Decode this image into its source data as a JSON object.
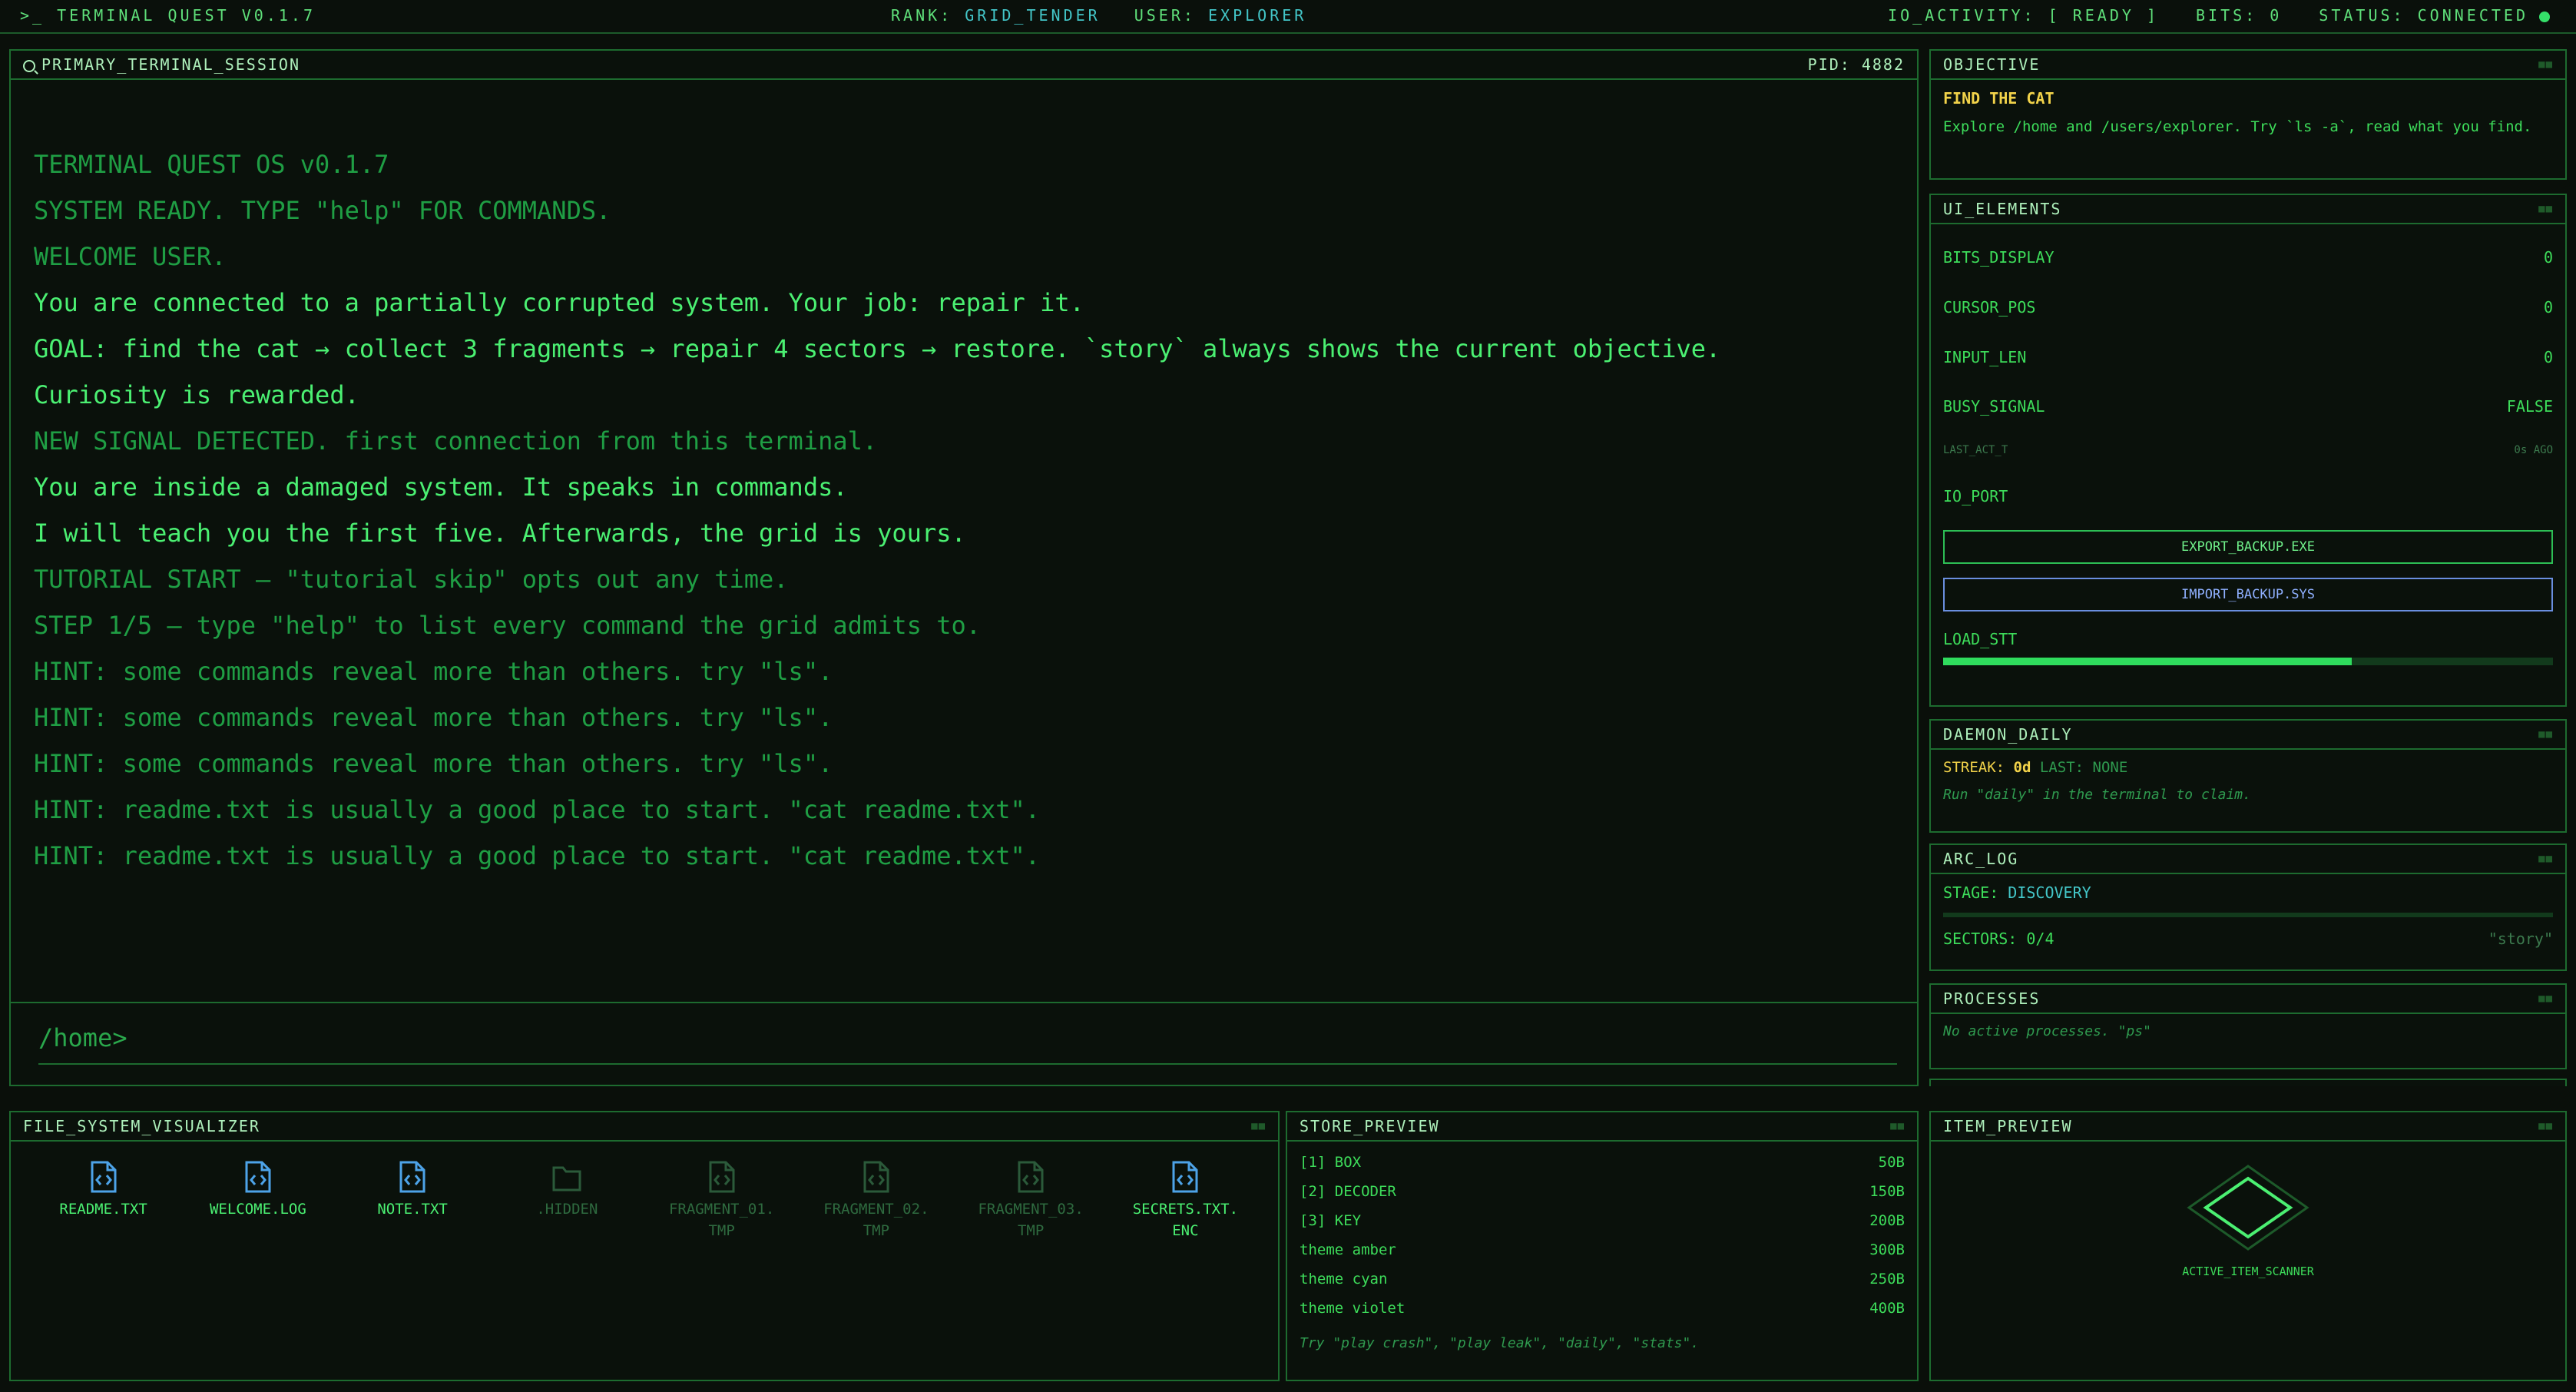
{
  "topbar": {
    "title": ">_ TERMINAL QUEST V0.1.7",
    "rank_label": "RANK:",
    "rank_value": "GRID_TENDER",
    "user_label": "USER:",
    "user_value": "EXPLORER",
    "io_activity": "IO_ACTIVITY: [ READY ]",
    "bits": "BITS: 0",
    "status": "STATUS: CONNECTED",
    "status_color": "#35e06a"
  },
  "terminal": {
    "title": "PRIMARY_TERMINAL_SESSION",
    "pid": "PID: 4882",
    "lines": [
      "TERMINAL QUEST OS v0.1.7",
      "SYSTEM READY. TYPE \"help\" FOR COMMANDS.",
      "WELCOME USER.",
      "You are connected to a partially corrupted system. Your job: repair it.",
      "GOAL: find the cat → collect 3 fragments → repair 4 sectors → restore. `story` always shows the current objective.",
      "Curiosity is rewarded.",
      "NEW SIGNAL DETECTED. first connection from this terminal.",
      "You are inside a damaged system. It speaks in commands.",
      "I will teach you the first five. Afterwards, the grid is yours.",
      "TUTORIAL START — \"tutorial skip\" opts out any time.",
      "STEP 1/5 — type \"help\" to list every command the grid admits to.",
      "HINT: some commands reveal more than others. try \"ls\".",
      "HINT: some commands reveal more than others. try \"ls\".",
      "HINT: some commands reveal more than others. try \"ls\".",
      "HINT: readme.txt is usually a good place to start. \"cat readme.txt\".",
      "HINT: readme.txt is usually a good place to start. \"cat readme.txt\"."
    ],
    "prompt": "/home>"
  },
  "objective": {
    "title": "OBJECTIVE",
    "heading": "FIND THE CAT",
    "text": "Explore /home and /users/explorer. Try `ls -a`, read what you find."
  },
  "ui_elements": {
    "title": "UI_ELEMENTS",
    "bits_label": "BITS_DISPLAY",
    "bits_value": "0",
    "cursor_label": "CURSOR_POS",
    "cursor_value": "0",
    "input_label": "INPUT_LEN",
    "input_value": "0",
    "busy_label": "BUSY_SIGNAL",
    "busy_value": "FALSE",
    "last_act_label": "LAST_ACT_T",
    "last_act_value": "0s AGO",
    "io_port_label": "IO_PORT",
    "export_btn": "EXPORT_BACKUP.EXE",
    "import_btn": "IMPORT_BACKUP.SYS",
    "load_label": "LOAD_STT",
    "load_fraction": 0.67
  },
  "daemon": {
    "title": "DAEMON_DAILY",
    "streak_label": "STREAK:",
    "streak_value": "0d",
    "last_label": "LAST:",
    "last_value": "NONE",
    "hint": "Run \"daily\" in the terminal to claim."
  },
  "arc_log": {
    "title": "ARC_LOG",
    "stage_label": "STAGE:",
    "stage_value": "DISCOVERY",
    "sectors": "SECTORS: 0/4",
    "story_hint": "\"story\""
  },
  "processes": {
    "title": "PROCESSES",
    "text": "No active processes. \"ps\""
  },
  "file_system": {
    "title": "FILE_SYSTEM_VISUALIZER",
    "files": [
      {
        "name": "README.TXT",
        "icon": "code-file-icon",
        "dim": false
      },
      {
        "name": "WELCOME.LOG",
        "icon": "code-file-icon",
        "dim": false
      },
      {
        "name": "NOTE.TXT",
        "icon": "code-file-icon",
        "dim": false
      },
      {
        "name": ".HIDDEN",
        "icon": "folder-icon",
        "dim": true
      },
      {
        "name": "FRAGMENT_01.\nTMP",
        "icon": "code-file-icon",
        "dim": true
      },
      {
        "name": "FRAGMENT_02.\nTMP",
        "icon": "code-file-icon",
        "dim": true
      },
      {
        "name": "FRAGMENT_03.\nTMP",
        "icon": "code-file-icon",
        "dim": true
      },
      {
        "name": "SECRETS.TXT.\nENC",
        "icon": "code-file-icon",
        "dim": false
      }
    ]
  },
  "store": {
    "title": "STORE_PREVIEW",
    "items": [
      {
        "name": "[1] BOX",
        "price": "50B"
      },
      {
        "name": "[2] DECODER",
        "price": "150B"
      },
      {
        "name": "[3] KEY",
        "price": "200B"
      },
      {
        "name": "theme amber",
        "price": "300B"
      },
      {
        "name": "theme cyan",
        "price": "250B"
      },
      {
        "name": "theme violet",
        "price": "400B"
      }
    ],
    "hint": "Try \"play crash\", \"play leak\", \"daily\", \"stats\"."
  },
  "item_preview": {
    "title": "ITEM_PREVIEW",
    "label": "ACTIVE_ITEM_SCANNER"
  }
}
